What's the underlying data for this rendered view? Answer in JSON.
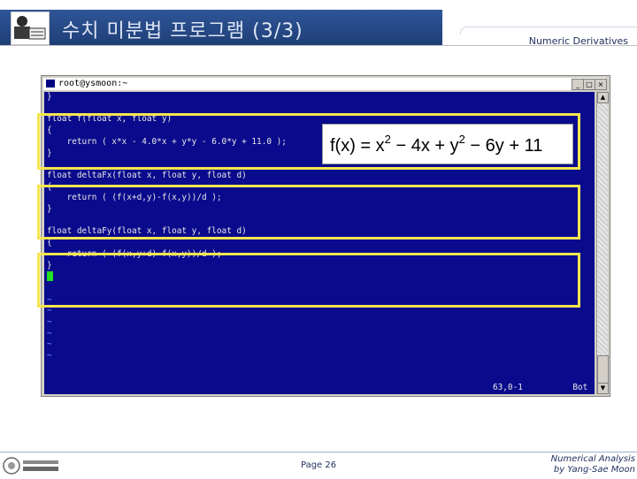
{
  "header": {
    "title": "수치 미분법 프로그램 (3/3)",
    "subtitle": "Numeric Derivatives"
  },
  "window": {
    "title": "root@ysmoon:~",
    "buttons": [
      "_",
      "□",
      "×"
    ],
    "code_lines": [
      "}",
      "",
      "float f(float x, float y)",
      "{",
      "    return ( x*x - 4.0*x + y*y - 6.0*y + 11.0 );",
      "}",
      "",
      "float deltaFx(float x, float y, float d)",
      "{",
      "    return ( (f(x+d,y)-f(x,y))/d );",
      "}",
      "",
      "float deltaFy(float x, float y, float d)",
      "{",
      "    return ( (f(x,y+d)-f(x,y))/d );",
      "}"
    ],
    "tildes": 6,
    "status_position": "63,0-1",
    "status_scroll": "Bot",
    "scroll_arrows": [
      "▲",
      "▼"
    ]
  },
  "formula": {
    "fx": "f(x) = x",
    "exp1": "2",
    "mid": " − 4x + y",
    "exp2": "2",
    "tail": " − 6y + 11"
  },
  "footer": {
    "page": "Page 26",
    "credit_line1": "Numerical Analysis",
    "credit_line2": "by Yang-Sae Moon"
  }
}
